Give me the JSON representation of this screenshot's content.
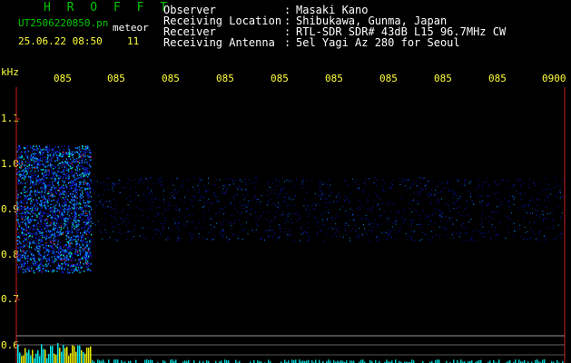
{
  "header": {
    "app_title": "H R O F F T",
    "filename": "UT2506220850.pn",
    "mode": "meteor",
    "datetime": "25.06.22 08:50",
    "count": "11"
  },
  "info": [
    {
      "label": "Observer",
      "sep": ":",
      "value": "Masaki Kano"
    },
    {
      "label": "Receiving Location",
      "sep": ":",
      "value": "Shibukawa, Gunma, Japan"
    },
    {
      "label": "Receiver",
      "sep": ":",
      "value": "RTL-SDR SDR# 43dB L15 96.7MHz CW"
    },
    {
      "label": "Receiving Antenna",
      "sep": ":",
      "value": "5el Yagi Az 280 for Seoul"
    }
  ],
  "axis": {
    "y_unit": "kHz",
    "x_ticks": [
      "085",
      "085",
      "085",
      "085",
      "085",
      "085",
      "085",
      "085",
      "085",
      "0900"
    ],
    "y_ticks": [
      "1.1",
      "1.0",
      "0.9",
      "0.8",
      "0.7",
      "0.6"
    ]
  },
  "colors": {
    "background": "#000000",
    "info_text": "#ffffff",
    "title": "#00c800",
    "axis_text": "#ffff3c",
    "axis_line": "#cc2222",
    "signal_low": "#0a14b4",
    "signal_mid": "#0a8cff",
    "signal_high": "#00e6c8",
    "signal_peak": "#e63232"
  }
}
